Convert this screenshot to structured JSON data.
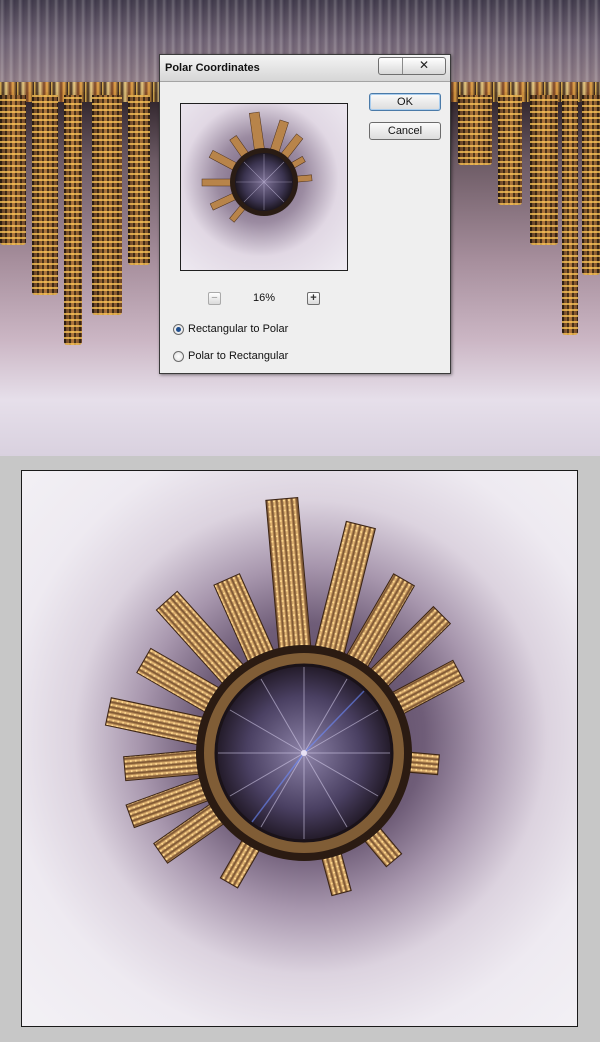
{
  "dialog": {
    "title": "Polar Coordinates",
    "close_glyph": "✕",
    "ok_label": "OK",
    "cancel_label": "Cancel",
    "zoom": {
      "value": "16%",
      "minus_label": "−",
      "plus_label": "+"
    },
    "options": [
      {
        "label": "Rectangular to Polar",
        "checked": true
      },
      {
        "label": "Polar to Rectangular",
        "checked": false
      }
    ]
  },
  "icons": {
    "close": "close-icon",
    "zoom_out": "zoom-out-icon",
    "zoom_in": "zoom-in-icon"
  },
  "colors": {
    "dialog_bg": "#efefef",
    "page_bg": "#c7c7c7",
    "radio_selected": "#1f4f8f"
  }
}
